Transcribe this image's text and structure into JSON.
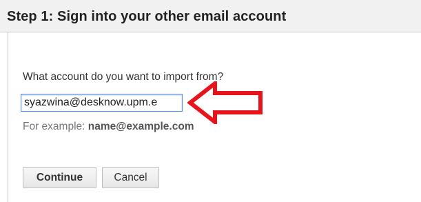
{
  "header": {
    "title": "Step 1: Sign into your other email account"
  },
  "form": {
    "question": "What account do you want to import from?",
    "email_value": "syazwina@desknow.upm.e",
    "example_prefix": "For example: ",
    "example_value": "name@example.com",
    "continue_label": "Continue",
    "cancel_label": "Cancel"
  },
  "annotation": {
    "arrow_color": "#e8141b"
  },
  "colors": {
    "header_bg": "#f1f1f1",
    "focus_border": "#4d90fe"
  }
}
